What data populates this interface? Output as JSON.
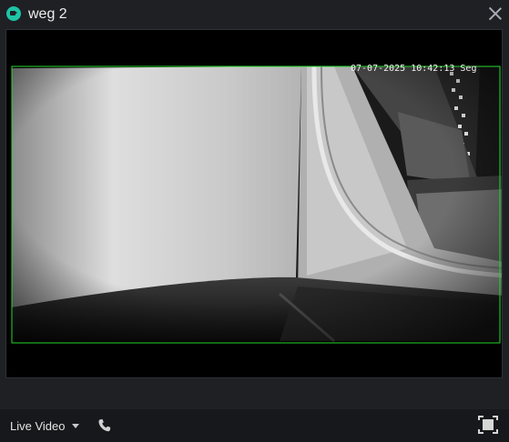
{
  "window": {
    "title": "weg 2",
    "app_icon": "camera-icon",
    "close_icon": "close-icon"
  },
  "video": {
    "osd_timestamp": "07-07-2025 10:42:13 Seg",
    "detection_box_color": "#26d92c"
  },
  "controls": {
    "mode_label": "Live Video",
    "mode_dropdown_icon": "caret-down-icon",
    "talk_icon": "phone-icon",
    "fullscreen_icon": "fullscreen-icon"
  },
  "colors": {
    "accent": "#1fc3a6",
    "background": "#1e2024",
    "toolbar": "#16181b"
  }
}
